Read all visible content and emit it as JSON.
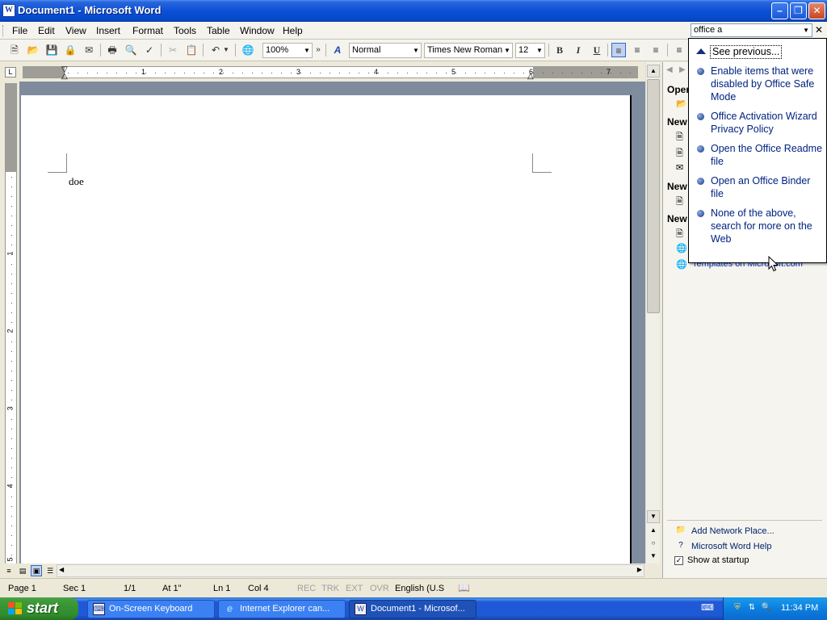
{
  "window": {
    "title": "Document1 - Microsoft Word"
  },
  "menu": [
    "File",
    "Edit",
    "View",
    "Insert",
    "Format",
    "Tools",
    "Table",
    "Window",
    "Help"
  ],
  "toolbar": {
    "zoom": "100%",
    "style": "Normal",
    "font": "Times New Roman",
    "font_size": "12",
    "bold": "B",
    "italic": "I",
    "underline": "U"
  },
  "ruler_numbers": [
    "1",
    "2",
    "3",
    "4",
    "5",
    "6",
    "7"
  ],
  "vruler_numbers": [
    "1",
    "2",
    "3",
    "4",
    "5"
  ],
  "document": {
    "text": "doe"
  },
  "help_search": {
    "query": "office a"
  },
  "popup": {
    "see_previous": "See previous...",
    "items": [
      "Enable items that were disabled by Office Safe Mode",
      "Office Activation Wizard Privacy Policy",
      "Open the Office Readme file",
      "Open an Office Binder file",
      "None of the above, search for more on the Web"
    ]
  },
  "task_pane": {
    "open_header": "Oper",
    "new_header_1": "New",
    "new_header_2": "New",
    "new_header_3": "New",
    "templates_link": "Templates on Microsoft.com",
    "add_network_place": "Add Network Place...",
    "word_help": "Microsoft Word Help",
    "show_at_startup": "Show at startup"
  },
  "status": {
    "page": "Page 1",
    "sec": "Sec 1",
    "pages": "1/1",
    "at": "At 1\"",
    "ln": "Ln 1",
    "col": "Col 4",
    "rec": "REC",
    "trk": "TRK",
    "ext": "EXT",
    "ovr": "OVR",
    "language": "English (U.S"
  },
  "taskbar": {
    "start": "start",
    "tasks": [
      "On-Screen Keyboard",
      "Internet Explorer can...",
      "Document1 - Microsof..."
    ],
    "time": "11:34 PM"
  }
}
